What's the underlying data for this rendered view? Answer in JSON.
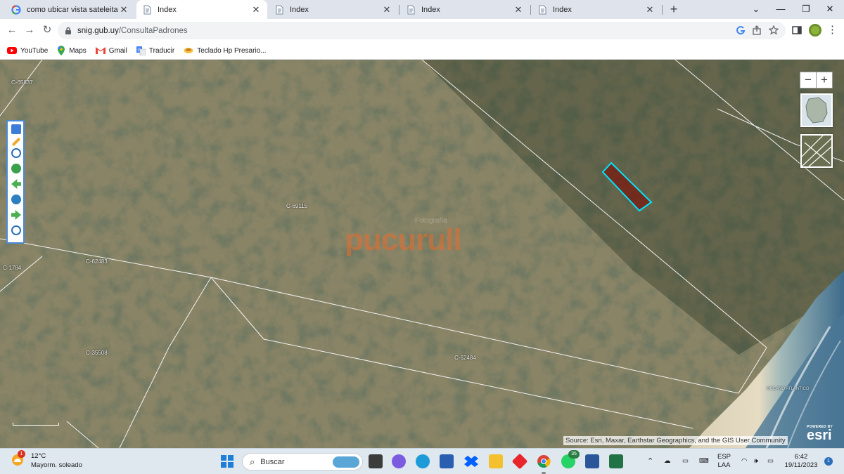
{
  "browser": {
    "tabs": [
      {
        "title": "como ubicar vista sateleital por",
        "icon": "google-icon",
        "active": false
      },
      {
        "title": "Index",
        "icon": "document-icon",
        "active": true
      },
      {
        "title": "Index",
        "icon": "document-icon",
        "active": false
      },
      {
        "title": "Index",
        "icon": "document-icon",
        "active": false
      },
      {
        "title": "Index",
        "icon": "document-icon",
        "active": false
      }
    ],
    "new_tab": "+",
    "url_host": "snig.gub.uy",
    "url_path": "/ConsultaPadrones"
  },
  "bookmarks": [
    {
      "label": "YouTube",
      "icon": "youtube-icon"
    },
    {
      "label": "Maps",
      "icon": "maps-icon"
    },
    {
      "label": "Gmail",
      "icon": "gmail-icon"
    },
    {
      "label": "Traducir",
      "icon": "translate-icon"
    },
    {
      "label": "Teclado Hp Presario...",
      "icon": "keyboard-bookmark-icon"
    }
  ],
  "map": {
    "parcels": [
      {
        "label": "C-65837"
      },
      {
        "label": "C-69115"
      },
      {
        "label": "C-62483"
      },
      {
        "label": "C-1784"
      },
      {
        "label": "C-35508"
      },
      {
        "label": "C-62484"
      }
    ],
    "zoom_out": "−",
    "zoom_in": "+",
    "watermark_small": "Fotografía",
    "watermark_big": "pucurull",
    "attribution": "Source: Esri, Maxar, Earthstar Geographics, and the GIS User Community",
    "esri_powered": "POWERED BY",
    "esri_name": "esri",
    "ocean_label": "OCEANO ATLANTICO",
    "highlight_color": "#00e5ff"
  },
  "taskbar": {
    "weather_badge": "1",
    "temperature": "12°C",
    "condition": "Mayorm. soleado",
    "search_placeholder": "Buscar",
    "whatsapp_badge": "35",
    "language": "ESP",
    "layout": "LAA",
    "time": "6:42",
    "date": "19/11/2023",
    "notification_badge": "1"
  }
}
